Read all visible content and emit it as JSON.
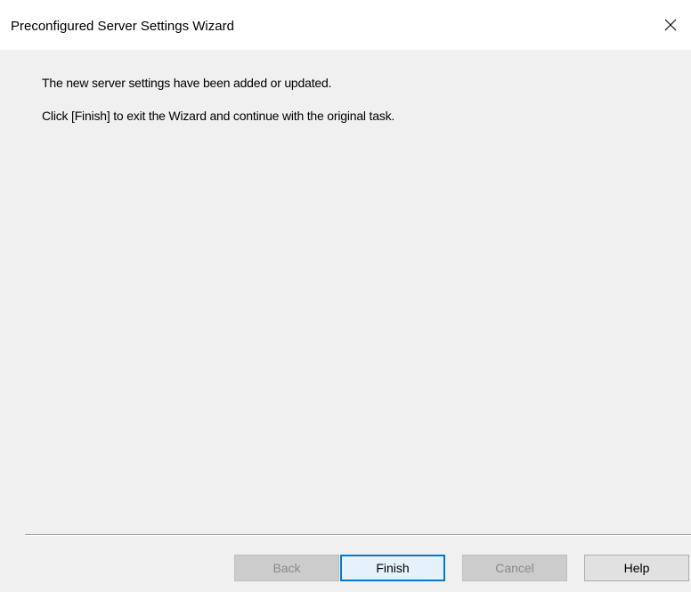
{
  "window": {
    "title": "Preconfigured Server Settings Wizard",
    "close_icon": "close-icon"
  },
  "body": {
    "line1": "The new server settings have been added or updated.",
    "line2": "Click [Finish] to exit the Wizard and continue with the original task."
  },
  "buttons": {
    "back": {
      "label": "Back",
      "enabled": false
    },
    "finish": {
      "label": "Finish",
      "enabled": true,
      "default": true
    },
    "cancel": {
      "label": "Cancel",
      "enabled": false
    },
    "help": {
      "label": "Help",
      "enabled": true
    }
  },
  "colors": {
    "titlebar_bg": "#ffffff",
    "dialog_bg": "#f0f0f0",
    "default_button_border": "#0078d7",
    "disabled_text": "#8a8a8a"
  }
}
